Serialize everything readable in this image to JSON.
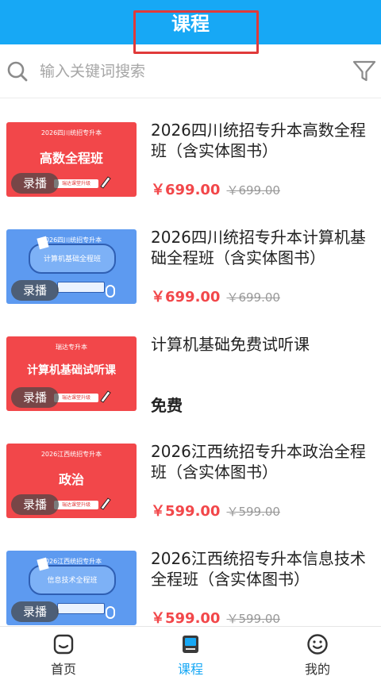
{
  "header": {
    "title": "课程",
    "bg_color": "#17a8f5"
  },
  "search": {
    "placeholder": "输入关键词搜索",
    "value": ""
  },
  "accent_colors": {
    "price": "#f2474a",
    "active_tab": "#17a8f5",
    "highlight_box": "#e03a3a"
  },
  "courses": [
    {
      "title": "2026四川统招专升本高数全程班（含实体图书）",
      "price": "￥699.00",
      "original_price": "￥699.00",
      "badge": "录播",
      "thumb": {
        "style": "red",
        "top_text": "2026四川统招专升本",
        "main_text": "高数全程班",
        "chip_text": "瑞达课堂升级"
      }
    },
    {
      "title": "2026四川统招专升本计算机基础全程班（含实体图书）",
      "price": "￥699.00",
      "original_price": "￥699.00",
      "badge": "录播",
      "thumb": {
        "style": "blue",
        "top_text": "2026四川统招专升本",
        "main_text": "计算机基础全程班"
      }
    },
    {
      "title": "计算机基础免费试听课",
      "free_label": "免费",
      "badge": "录播",
      "thumb": {
        "style": "red",
        "top_text": "瑞达专升本",
        "main_text": "计算机基础试听课",
        "chip_text": "瑞达课堂升级"
      }
    },
    {
      "title": "2026江西统招专升本政治全程班（含实体图书）",
      "price": "￥599.00",
      "original_price": "￥599.00",
      "badge": "录播",
      "thumb": {
        "style": "red",
        "top_text": "2026江西统招专升本",
        "main_text": "政治",
        "chip_text": "瑞达课堂升级"
      }
    },
    {
      "title": "2026江西统招专升本信息技术全程班（含实体图书）",
      "price": "￥599.00",
      "original_price": "￥599.00",
      "badge": "录播",
      "thumb": {
        "style": "blue",
        "top_text": "2026江西统招专升本",
        "main_text": "信息技术全程班"
      }
    }
  ],
  "bottom_nav": [
    {
      "label": "首页",
      "icon": "home-icon",
      "active": false
    },
    {
      "label": "课程",
      "icon": "course-book-icon",
      "active": true
    },
    {
      "label": "我的",
      "icon": "smiley-profile-icon",
      "active": false
    }
  ]
}
